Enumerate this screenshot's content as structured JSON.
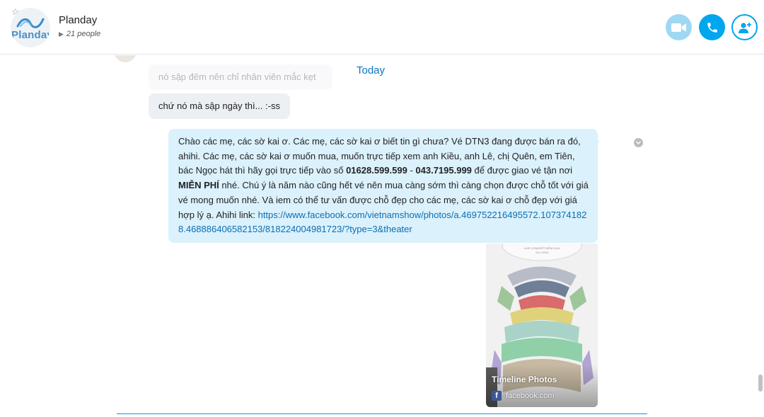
{
  "header": {
    "group_name": "Planday",
    "people_count": "21 people",
    "avatar_text": "Planday",
    "icons": {
      "favorite": "star-outline-icon",
      "video": "video-camera-icon",
      "call": "phone-icon",
      "add_people": "add-person-icon"
    }
  },
  "chat": {
    "date_separator": "Today",
    "messages": [
      {
        "text": "nó sập đêm nên chỉ nhân viên mắc kẹt",
        "direction": "incoming",
        "faded": true
      },
      {
        "text": "chứ nó mà sập ngày thì... :-ss",
        "direction": "incoming"
      },
      {
        "direction": "outgoing",
        "parts": {
          "p1": "Chào các mẹ, các sờ kai ơ. Các mẹ, các sờ kai ơ biết tin gì chưa? Vé DTN3 đang được bán ra đó, ahihi. Các mẹ, các sờ kai ơ muốn mua, muốn trực tiếp xem anh Kiều, anh Lê, chị Quên, em Tiên, bác Ngọc hát thì hãy gọi trực tiếp vào số ",
          "phone1": "01628.599.599",
          "sep": " - ",
          "phone2": "043.7195.999",
          "p2": " để được giao vé tận nơi ",
          "free": "MIỄN PHÍ",
          "p3": " nhé. Chú ý là năm nào cũng hết vé nên mua càng sớm thì càng chọn được chỗ tốt với giá vé mong muốn nhé. Và iem có thể tư vấn được chỗ đẹp cho các mẹ, các sờ kai ơ chỗ đẹp với giá hợp lý ạ. Ahihi link: ",
          "link": "https://www.facebook.com/vietnamshow/photos/a.469752216495572.1073741828.468886406582153/818224004981723/?type=3&theater"
        }
      }
    ],
    "link_preview": {
      "title": "Timeline Photos",
      "site": "facebook.com",
      "image": "concert-seating-chart"
    }
  },
  "colors": {
    "accent": "#00a6ee",
    "outgoing_bubble": "#dbf1fc",
    "incoming_bubble": "#eceff3",
    "link": "#0a6fb3"
  }
}
